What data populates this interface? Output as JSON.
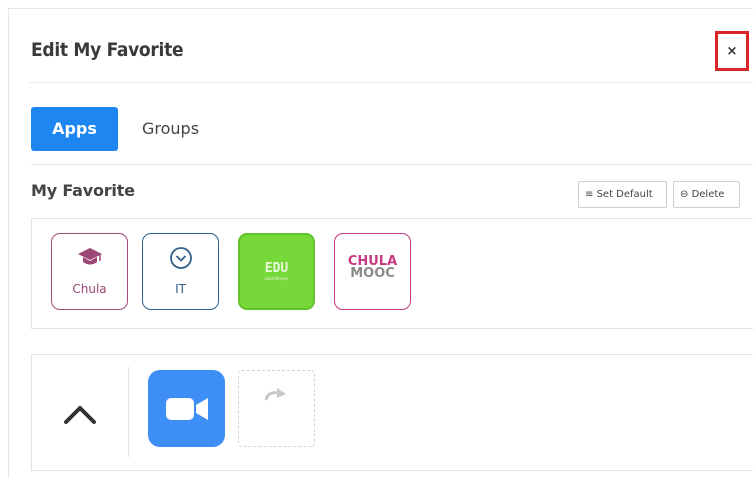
{
  "modal": {
    "title": "Edit My Favorite",
    "close_label": "×"
  },
  "tabs": [
    {
      "label": "Apps",
      "active": true
    },
    {
      "label": "Groups",
      "active": false
    }
  ],
  "favorite_section": {
    "title": "My Favorite",
    "set_default_icon": "≡",
    "set_default_label": "Set Default",
    "delete_icon": "⊖",
    "delete_label": "Delete",
    "apps": [
      {
        "label": "Chula",
        "icon": "graduation-cap-icon"
      },
      {
        "label": "IT",
        "icon": "chevron-down-circle-icon"
      },
      {
        "logo_text": "EDU",
        "logo_subtext": "LearnPlayer",
        "icon": "edu-logo"
      },
      {
        "logo_line1": "CHULA",
        "logo_line2": "MOOC",
        "icon": "chula-mooc-logo"
      }
    ]
  },
  "bottom_section": {
    "collapse_icon": "chevron-up-icon",
    "apps": [
      {
        "icon": "zoom-video-icon"
      },
      {
        "icon": "redo-arrow-icon",
        "placeholder": true
      }
    ]
  },
  "colors": {
    "accent": "#1e86f0",
    "close_border": "#d9262c",
    "chula": "#9b4674",
    "it": "#2f5f8a",
    "edu_green": "#77d83a",
    "zoom_blue": "#3d8ef5"
  }
}
